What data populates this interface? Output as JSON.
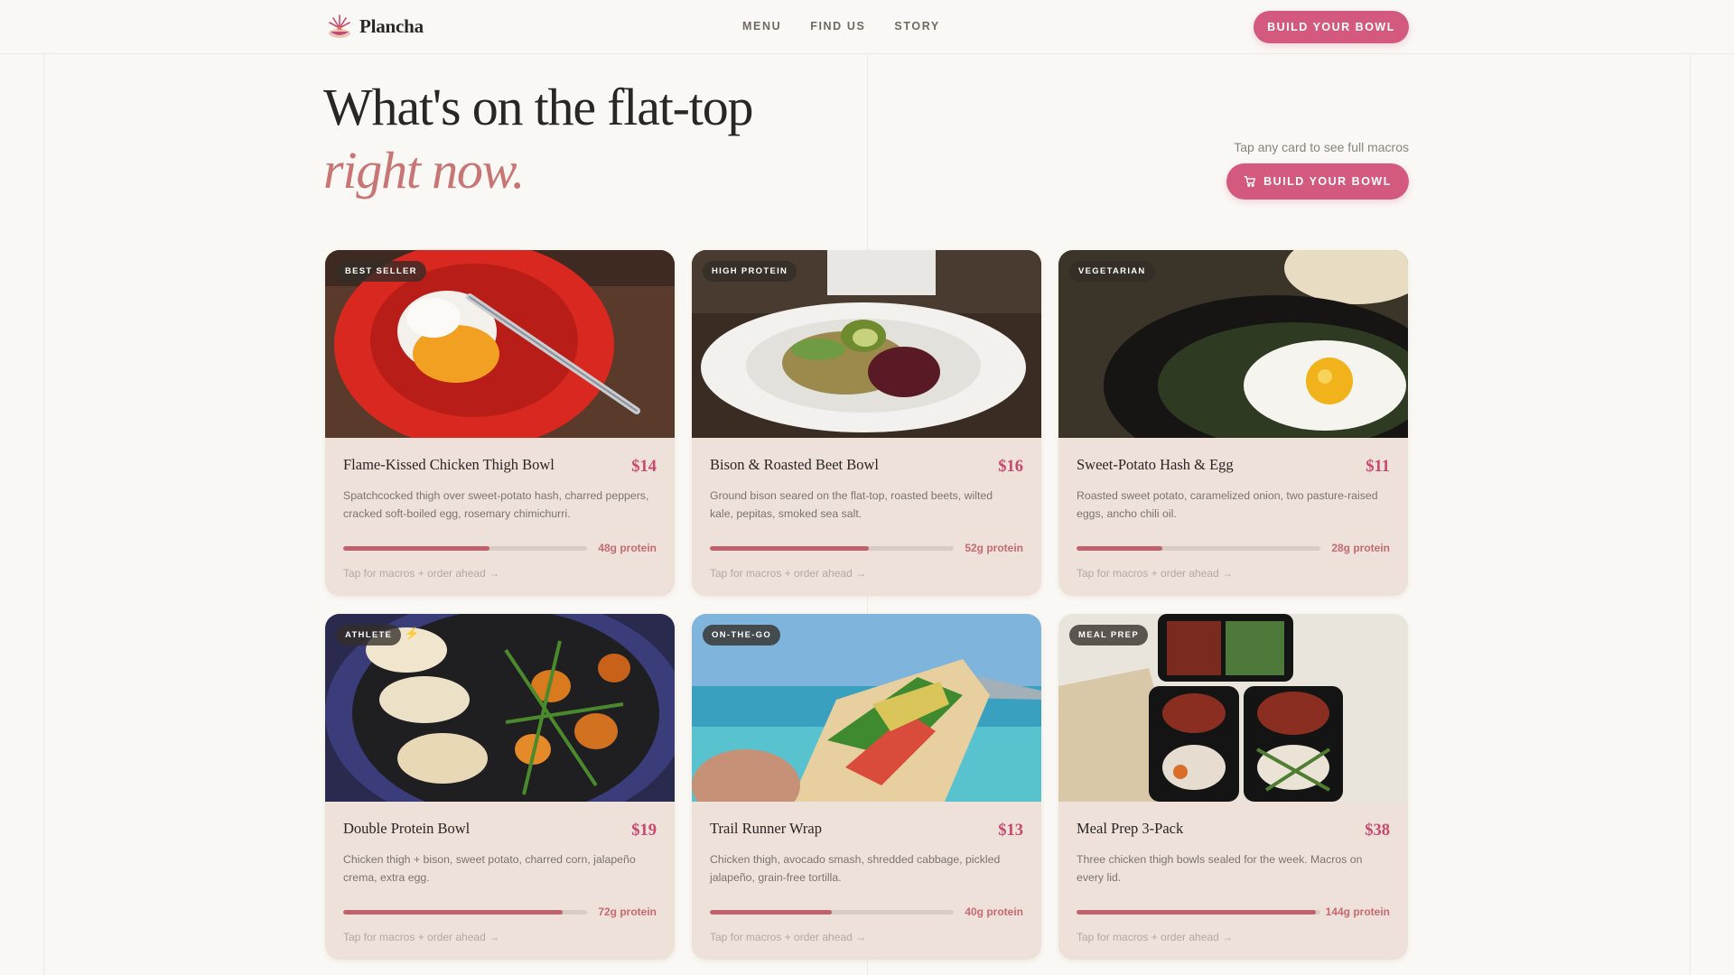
{
  "nav": {
    "brand": "Plancha",
    "links": [
      "MENU",
      "FIND US",
      "STORY"
    ],
    "cta": "BUILD YOUR BOWL"
  },
  "hero": {
    "title": "What's on the flat-top",
    "subtitle": "right now.",
    "hint": "Tap any card to see full macros",
    "cta": "BUILD YOUR BOWL"
  },
  "colors": {
    "accent": "#d35a7e",
    "price": "#c9486d",
    "protein_bar": "#c0626b",
    "card_bg": "#ede1d9"
  },
  "cards": [
    {
      "badge": "BEST SELLER",
      "name": "Flame-Kissed Chicken Thigh Bowl",
      "price": "$14",
      "desc": "Spatchcocked thigh over sweet-potato hash, charred peppers, cracked soft-boiled egg, rosemary chimichurri.",
      "protein": "48g protein",
      "protein_fraction": 0.6,
      "cta": "Tap for macros + order ahead →"
    },
    {
      "badge": "HIGH PROTEIN",
      "name": "Bison & Roasted Beet Bowl",
      "price": "$16",
      "desc": "Ground bison seared on the flat-top, roasted beets, wilted kale, pepitas, smoked sea salt.",
      "protein": "52g protein",
      "protein_fraction": 0.65,
      "cta": "Tap for macros + order ahead →"
    },
    {
      "badge": "VEGETARIAN",
      "name": "Sweet-Potato Hash & Egg",
      "price": "$11",
      "desc": "Roasted sweet potato, caramelized onion, two pasture-raised eggs, ancho chili oil.",
      "protein": "28g protein",
      "protein_fraction": 0.35,
      "cta": "Tap for macros + order ahead →"
    },
    {
      "badge": "ATHLETE",
      "bolt": "⚡",
      "name": "Double Protein Bowl",
      "price": "$19",
      "desc": "Chicken thigh + bison, sweet potato, charred corn, jalapeño crema, extra egg.",
      "protein": "72g protein",
      "protein_fraction": 0.9,
      "cta": "Tap for macros + order ahead →"
    },
    {
      "badge": "ON-THE-GO",
      "name": "Trail Runner Wrap",
      "price": "$13",
      "desc": "Chicken thigh, avocado smash, shredded cabbage, pickled jalapeño, grain-free tortilla.",
      "protein": "40g protein",
      "protein_fraction": 0.5,
      "cta": "Tap for macros + order ahead →"
    },
    {
      "badge": "MEAL PREP",
      "name": "Meal Prep 3-Pack",
      "price": "$38",
      "desc": "Three chicken thigh bowls sealed for the week. Macros on every lid.",
      "protein": "144g protein",
      "protein_fraction": 0.98,
      "cta": "Tap for macros + order ahead →"
    }
  ]
}
